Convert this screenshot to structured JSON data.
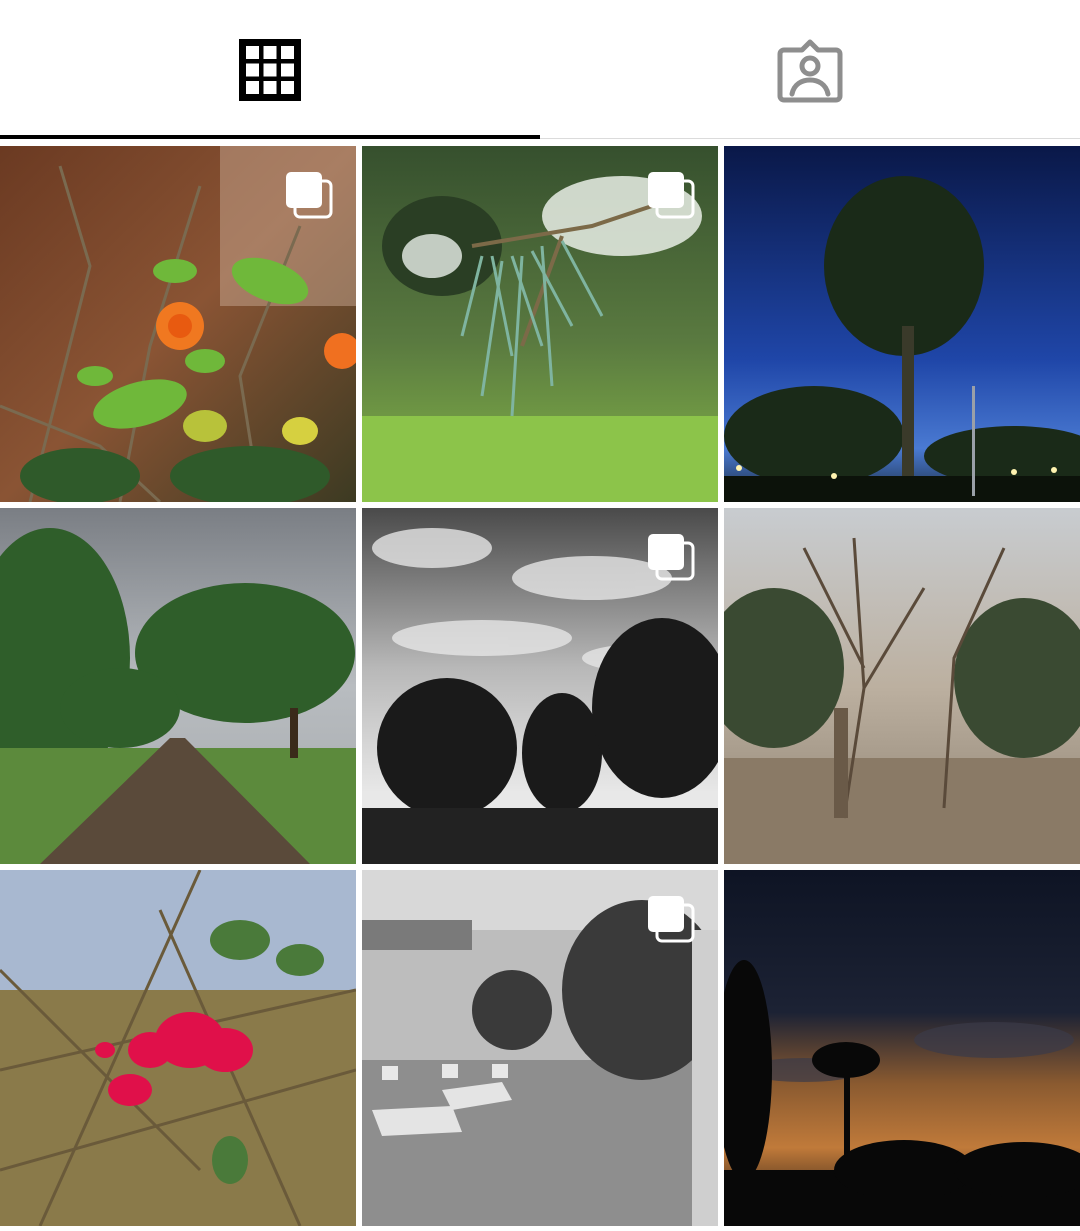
{
  "tabs": [
    {
      "id": "posts",
      "icon": "grid-icon",
      "selected": true
    },
    {
      "id": "tagged",
      "icon": "tagged-person-icon",
      "selected": false
    }
  ],
  "posts": [
    {
      "subject": "orange-marigold-flowers",
      "multiple": true
    },
    {
      "subject": "pine-branch-closeup",
      "multiple": true
    },
    {
      "subject": "tree-at-night-blue-sky",
      "multiple": false
    },
    {
      "subject": "tree-lined-road-cloudy",
      "multiple": false
    },
    {
      "subject": "black-white-sky-trees",
      "multiple": true
    },
    {
      "subject": "bare-trees-dusk",
      "multiple": false
    },
    {
      "subject": "pink-bougainvillea-flower",
      "multiple": false
    },
    {
      "subject": "black-white-courtyard",
      "multiple": true
    },
    {
      "subject": "palm-silhouette-sunset",
      "multiple": false
    }
  ],
  "colors": {
    "indicator": "#000000",
    "inactive_icon": "#8e8e8e",
    "badge": "#ffffff"
  }
}
